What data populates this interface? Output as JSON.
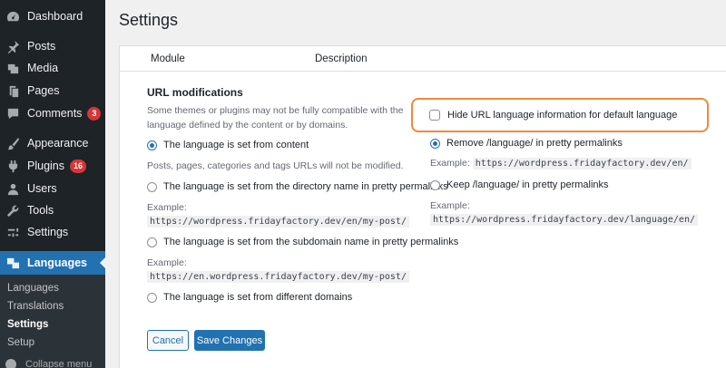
{
  "sidebar": {
    "items": [
      {
        "label": "Dashboard",
        "icon": "dashboard-icon"
      },
      {
        "label": "Posts",
        "icon": "pin-icon"
      },
      {
        "label": "Media",
        "icon": "media-icon"
      },
      {
        "label": "Pages",
        "icon": "pages-icon"
      },
      {
        "label": "Comments",
        "icon": "comment-icon",
        "badge": "3"
      },
      {
        "label": "Appearance",
        "icon": "paintbrush-icon"
      },
      {
        "label": "Plugins",
        "icon": "plugin-icon",
        "badge": "16"
      },
      {
        "label": "Users",
        "icon": "user-icon"
      },
      {
        "label": "Tools",
        "icon": "wrench-icon"
      },
      {
        "label": "Settings",
        "icon": "settings-icon"
      },
      {
        "label": "Languages",
        "icon": "translation-icon"
      }
    ],
    "submenu": [
      "Languages",
      "Translations",
      "Settings",
      "Setup"
    ],
    "collapse_label": "Collapse menu"
  },
  "page": {
    "title": "Settings",
    "table_headers": {
      "module": "Module",
      "description": "Description"
    }
  },
  "url_mods": {
    "title": "URL modifications",
    "description": "Some themes or plugins may not be fully compatible with the language defined by the content or by domains.",
    "option_content": "The language is set from content",
    "option_content_note": "Posts, pages, categories and tags URLs will not be modified.",
    "option_directory": "The language is set from the directory name in pretty permalinks",
    "example_label": "Example:",
    "option_directory_example": "https://wordpress.fridayfactory.dev/en/my-post/",
    "option_subdomain": "The language is set from the subdomain name in pretty permalinks",
    "option_subdomain_example": "https://en.wordpress.fridayfactory.dev/my-post/",
    "option_domains": "The language is set from different domains",
    "hide_default": "Hide URL language information for default language",
    "remove_language": "Remove /language/ in pretty permalinks",
    "remove_language_example": "https://wordpress.fridayfactory.dev/en/",
    "keep_language": "Keep /language/ in pretty permalinks",
    "keep_language_example": "https://wordpress.fridayfactory.dev/language/en/"
  },
  "buttons": {
    "cancel": "Cancel",
    "save": "Save Changes"
  },
  "colors": {
    "accent": "#2271b1",
    "sidebar": "#1d2327",
    "highlight_border": "#f0883e",
    "badge": "#d63638"
  }
}
